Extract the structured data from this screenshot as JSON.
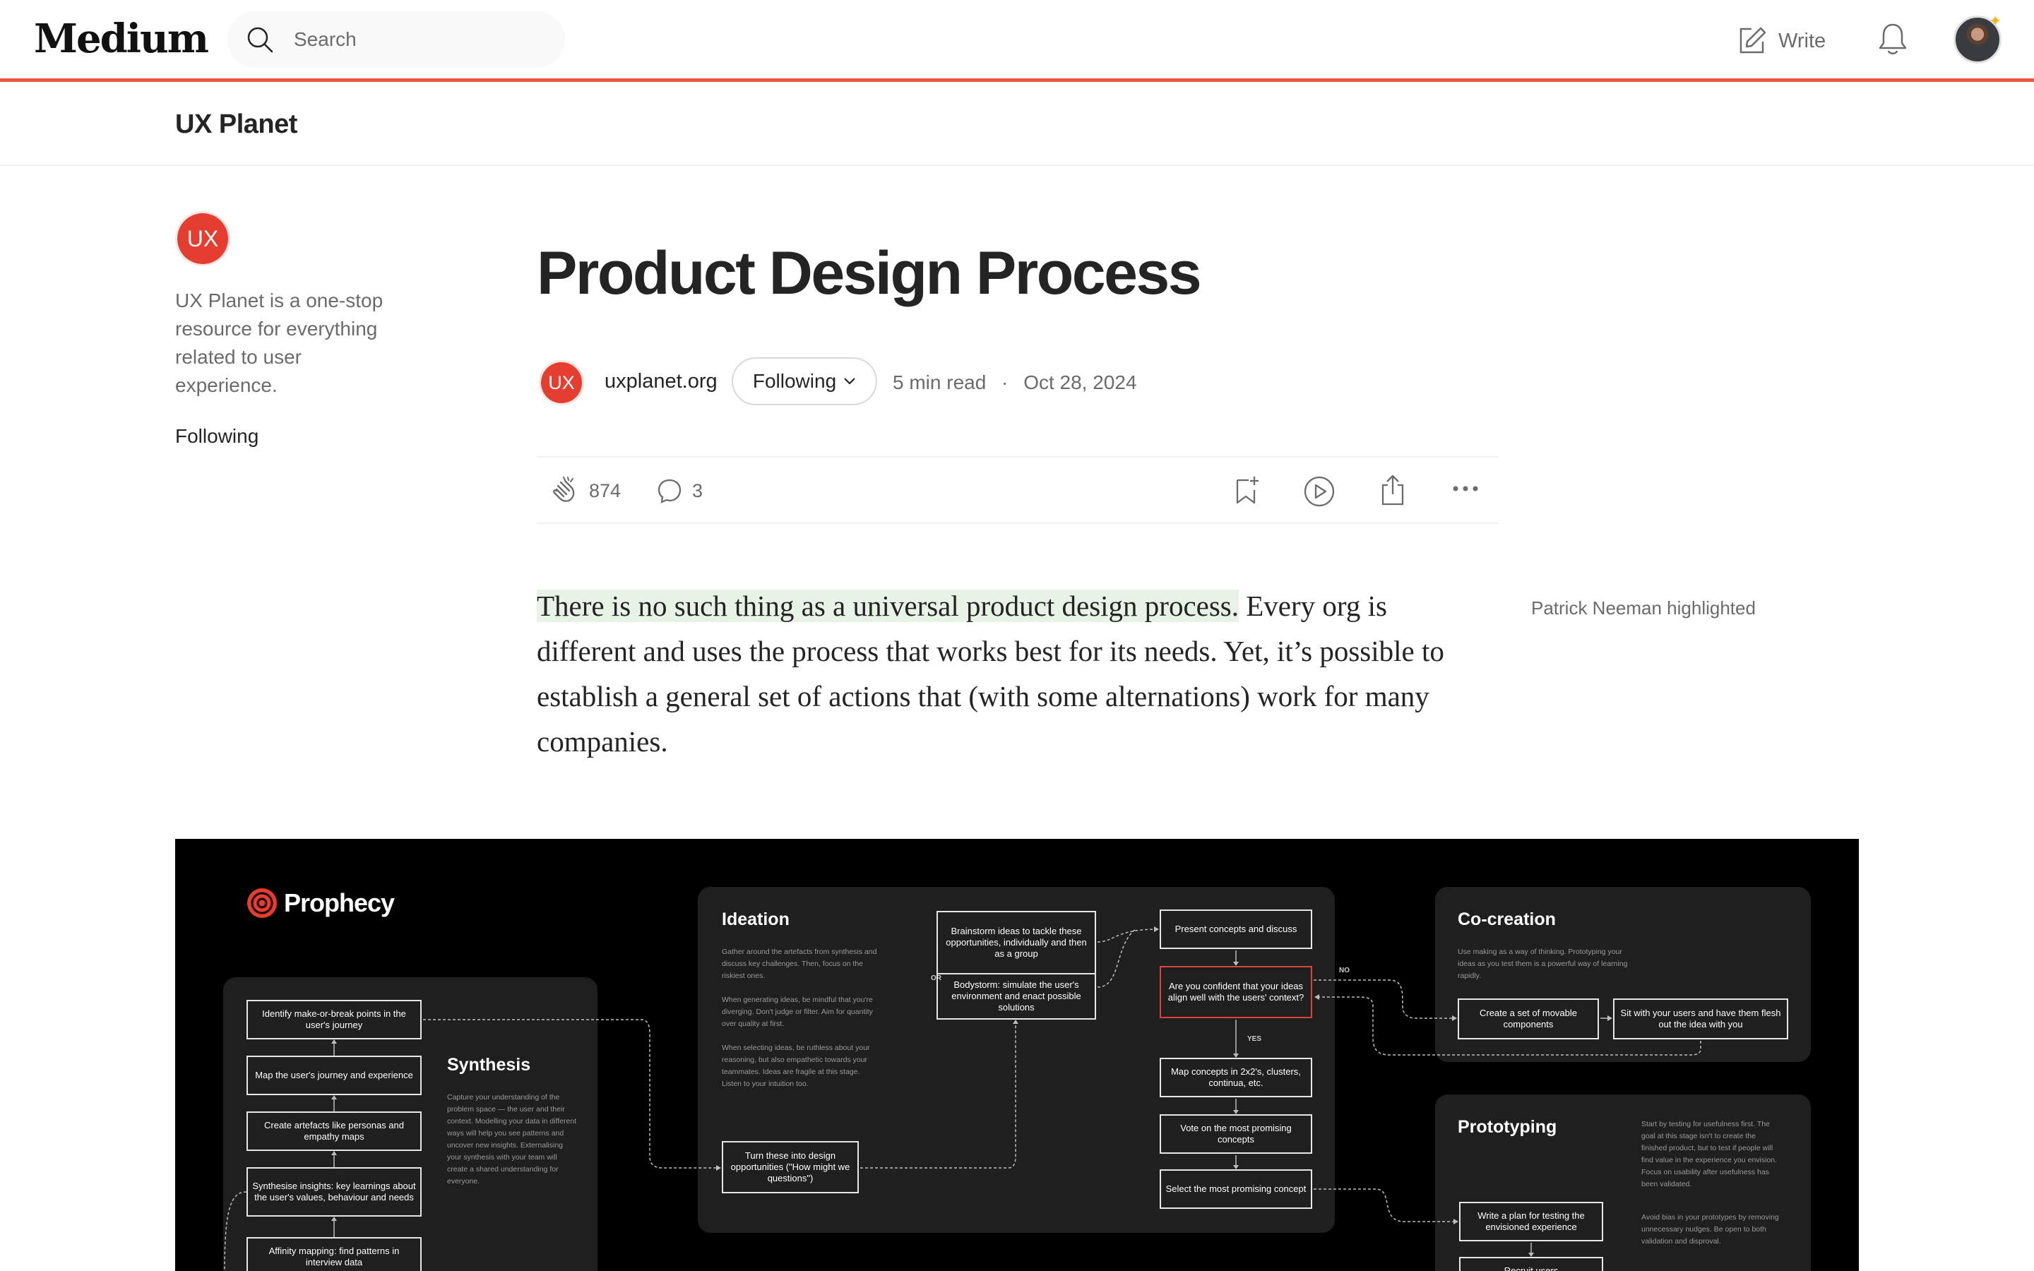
{
  "header": {
    "logo": "Medium",
    "search_placeholder": "Search",
    "write_label": "Write"
  },
  "publication": {
    "name": "UX Planet",
    "badge": "UX",
    "description": "UX Planet is a one-stop resource for everything related to user experience.",
    "following_label": "Following"
  },
  "article": {
    "title": "Product Design Process",
    "author": "uxplanet.org",
    "author_badge": "UX",
    "follow_label": "Following",
    "read_time": "5 min read",
    "separator": "·",
    "date": "Oct 28, 2024",
    "claps": "874",
    "comments": "3",
    "highlighted_text": "There is no such thing as a universal product design process.",
    "body_rest": " Every org is different and uses the process that works best for its needs. Yet, it’s possible to establish a general set of actions that (with some alternations) work for many companies.",
    "highlight_note": "Patrick Neeman highlighted"
  },
  "diagram": {
    "brand": "Prophecy",
    "synthesis": {
      "title": "Synthesis",
      "desc": "Capture your understanding of the problem space — the user and their context. Modelling your data in different ways will help you see patterns and uncover new insights. Externalising your synthesis with your team will create a shared understanding for everyone.",
      "nodes": [
        "Identify make-or-break points in the user's journey",
        "Map the user's journey and experience",
        "Create artefacts like personas and empathy maps",
        "Synthesise insights: key learnings about the user's values, behaviour and needs",
        "Affinity mapping: find patterns in interview data"
      ]
    },
    "ideation": {
      "title": "Ideation",
      "desc1": "Gather around the artefacts from synthesis and discuss key challenges. Then, focus on the riskiest ones.",
      "desc2": "When generating ideas, be mindful that you're diverging. Don't judge or filter. Aim for quantity over quality at first.",
      "desc3": "When selecting ideas, be ruthless about your reasoning, but also empathetic towards your teammates. Ideas are fragile at this stage. Listen to your intuition too.",
      "turn": "Turn these into design opportunities (\"How might we questions\")",
      "brainstorm": "Brainstorm ideas to tackle these opportunities, individually and then as a group",
      "or_label": "OR",
      "bodystorm": "Bodystorm: simulate the user's environment and enact possible solutions",
      "present": "Present concepts and discuss",
      "confident": "Are you confident that your ideas align well with the users' context?",
      "no_label": "NO",
      "yes_label": "YES",
      "map": "Map concepts in 2x2's, clusters, continua, etc.",
      "vote": "Vote on the most promising concepts",
      "select": "Select the most promising concept"
    },
    "cocreation": {
      "title": "Co-creation",
      "desc": "Use making as a way of thinking. Prototyping your ideas as you test them is a powerful way of learning rapidly.",
      "node1": "Create a set of movable components",
      "node2": "Sit with your users and have them flesh out the idea with you"
    },
    "prototyping": {
      "title": "Prototyping",
      "desc1": "Start by testing for usefulness first. The goal at this stage isn't to create the finished product, but to test if people will find value in the experience you envision. Focus on usability after usefulness has been validated.",
      "desc2": "Avoid bias in your prototypes by removing unnecessary nudges. Be open to both validation and disproval.",
      "node1": "Write a plan for testing the envisioned experience",
      "node2": "Recruit users"
    }
  }
}
